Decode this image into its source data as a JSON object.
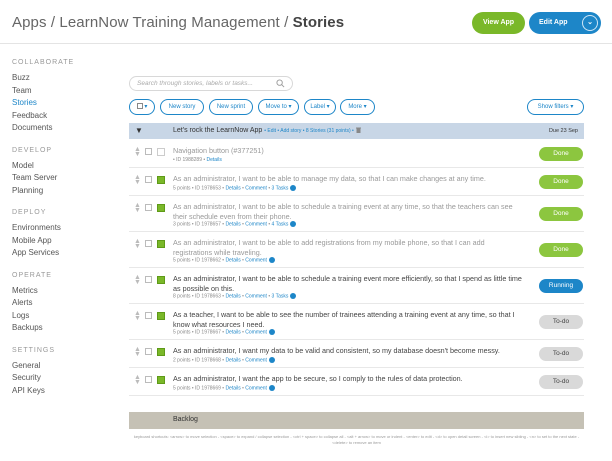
{
  "header": {
    "breadcrumb_prefix": "Apps / LearnNow Training Management / ",
    "breadcrumb_current": "Stories",
    "view_app": "View App",
    "edit_app": "Edit App",
    "edit_caret": "⌄"
  },
  "sidebar": {
    "sections": [
      {
        "title": "COLLABORATE",
        "items": [
          "Buzz",
          "Team",
          "Stories",
          "Feedback",
          "Documents"
        ]
      },
      {
        "title": "DEVELOP",
        "items": [
          "Model",
          "Team Server",
          "Planning"
        ]
      },
      {
        "title": "DEPLOY",
        "items": [
          "Environments",
          "Mobile App",
          "App Services"
        ]
      },
      {
        "title": "OPERATE",
        "items": [
          "Metrics",
          "Alerts",
          "Logs",
          "Backups"
        ]
      },
      {
        "title": "SETTINGS",
        "items": [
          "General",
          "Security",
          "API Keys"
        ]
      }
    ],
    "active_item": "Stories"
  },
  "search": {
    "placeholder": "Search through stories, labels or tasks..."
  },
  "toolbar": {
    "select_caret": "▾",
    "new_story": "New story",
    "new_sprint": "New sprint",
    "move_to": "Move to ▾",
    "label": "Label ▾",
    "more": "More ▾",
    "show_filters": "Show filters ▾"
  },
  "sprint": {
    "toggle": "▼",
    "name": "Let's rock the LearnNow App",
    "meta": "• Edit • Add story • 8 Stories (31 points) •",
    "due": "Due 23 Sep"
  },
  "stories": [
    {
      "text": "Navigation button (#377251)",
      "meta": "• ID 1988289 • Details",
      "links": false,
      "status": "Done",
      "kind": "done",
      "active": false
    },
    {
      "text": "As an administrator, I want to be able to manage my data, so that I can make changes at any time.",
      "meta": "5 points • ID 1978653 • Details • Comment • 3 Tasks",
      "status": "Done",
      "kind": "done",
      "active": false
    },
    {
      "text": "As an administrator, I want to be able to schedule a training event at any time, so that the teachers can see their schedule even from their phone.",
      "meta": "3 points • ID 1978657 • Details • Comment • 4 Tasks",
      "status": "Done",
      "kind": "done",
      "active": false
    },
    {
      "text": "As an administrator, I want to be able to add registrations from my mobile phone, so that I can add registrations while traveling.",
      "meta": "5 points • ID 1978662 • Details • Comment",
      "status": "Done",
      "kind": "done",
      "active": false
    },
    {
      "text": "As an administrator, I want to be able to schedule a training event more efficiently, so that I spend as little time as possible on this.",
      "meta": "8 points • ID 1978663 • Details • Comment • 3 Tasks",
      "status": "Running",
      "kind": "running",
      "active": true
    },
    {
      "text": "As a teacher, I want to be able to see the number of trainees attending a training event at any time, so that I know what resources I need.",
      "meta": "5 points • ID 1978667 • Details • Comment",
      "status": "To-do",
      "kind": "todo",
      "active": true
    },
    {
      "text": "As an administrator, I want my data to be valid and consistent, so my database doesn't become messy.",
      "meta": "2 points • ID 1978668 • Details • Comment",
      "status": "To-do",
      "kind": "todo",
      "active": true
    },
    {
      "text": "As an administrator, I want the app to be secure, so I comply to the rules of data protection.",
      "meta": "5 points • ID 1978669 • Details • Comment",
      "status": "To-do",
      "kind": "todo",
      "active": true
    }
  ],
  "backlog": {
    "label": "Backlog"
  },
  "shortcuts": "keyboard shortcuts: <arrow> to move selection - <space> to expand / collapse selection - <ctrl + space> to collapse all - <alt + arrow> to move or indent - <enter> to edit - <d> to open detail screen - <i> to insert new sibling - <n> to set to the next state - <delete> to remove an item",
  "colors": {
    "accent": "#1d86c8",
    "done": "#8cc63f",
    "view_app": "#7ab829",
    "sprint_bar": "#c8d6e6",
    "backlog_bar": "#c5c1b5"
  }
}
